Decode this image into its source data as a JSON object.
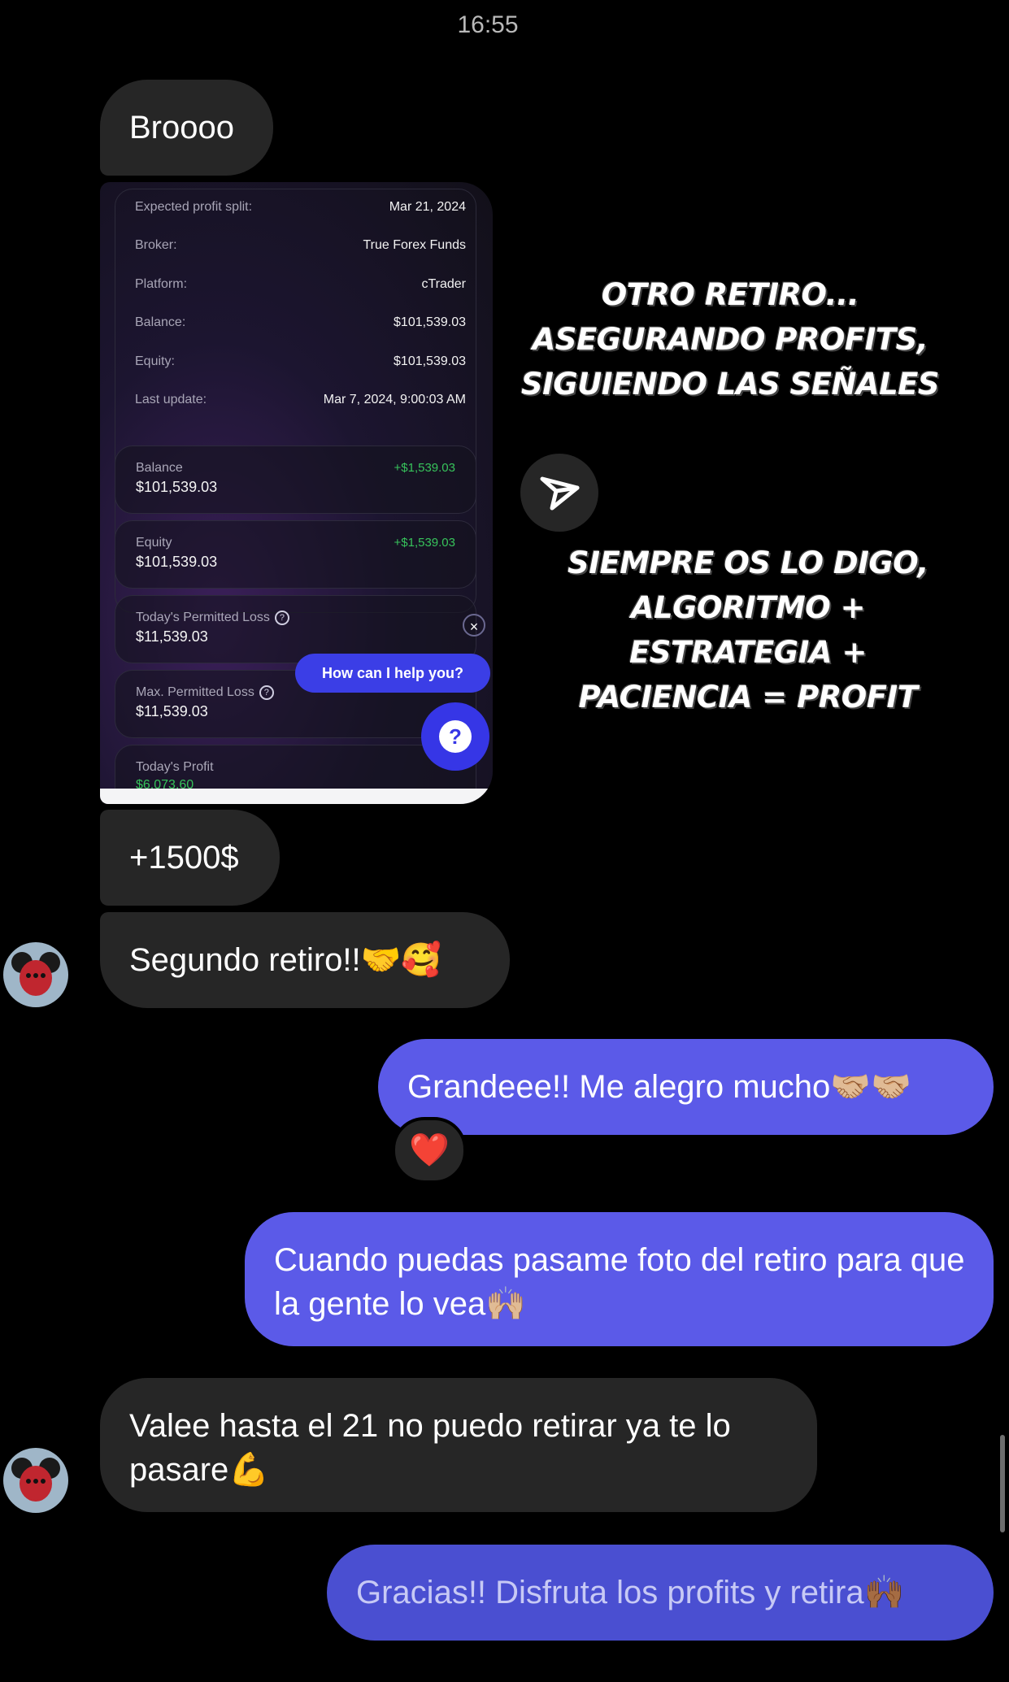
{
  "status": {
    "time": "16:55"
  },
  "messages": {
    "m1": "Broooo",
    "m3": "+1500$",
    "m4": "Segundo retiro!!🤝🥰",
    "m5": "Grandeee!! Me alegro mucho🤝🏼🤝🏼",
    "m5_reaction": "❤️",
    "m6": "Cuando puedas pasame foto del retiro para que la gente lo vea🙌🏼",
    "m7": "Valee hasta el 21 no puedo retirar ya te lo pasare💪",
    "m8": "Gracias!! Disfruta los profits y retira🙌🏾"
  },
  "screenshot": {
    "rows": [
      {
        "label": "Expected profit split:",
        "value": "Mar 21, 2024"
      },
      {
        "label": "Broker:",
        "value": "True Forex Funds"
      },
      {
        "label": "Platform:",
        "value": "cTrader"
      },
      {
        "label": "Balance:",
        "value": "$101,539.03"
      },
      {
        "label": "Equity:",
        "value": "$101,539.03"
      },
      {
        "label": "Last update:",
        "value": "Mar 7, 2024, 9:00:03 AM"
      }
    ],
    "cards": [
      {
        "label": "Balance",
        "value": "$101,539.03",
        "delta": "+$1,539.03"
      },
      {
        "label": "Equity",
        "value": "$101,539.03",
        "delta": "+$1,539.03"
      },
      {
        "label": "Today's Permitted Loss",
        "value": "$11,539.03"
      },
      {
        "label": "Max. Permitted Loss",
        "value": "$11,539.03"
      },
      {
        "label": "Today's Profit",
        "value": "$6,073.60"
      }
    ],
    "help_button": "How can I help you?",
    "close_glyph": "×",
    "fab_glyph": "?"
  },
  "overlay": {
    "line1": "OTRO RETIRO...",
    "line2": "ASEGURANDO PROFITS,",
    "line3": "SIGUIENDO LAS SEÑALES",
    "line4": "SIEMPRE OS LO DIGO,",
    "line5": "ALGORITMO +",
    "line6": "ESTRATEGIA +",
    "line7": "PACIENCIA = PROFIT"
  }
}
